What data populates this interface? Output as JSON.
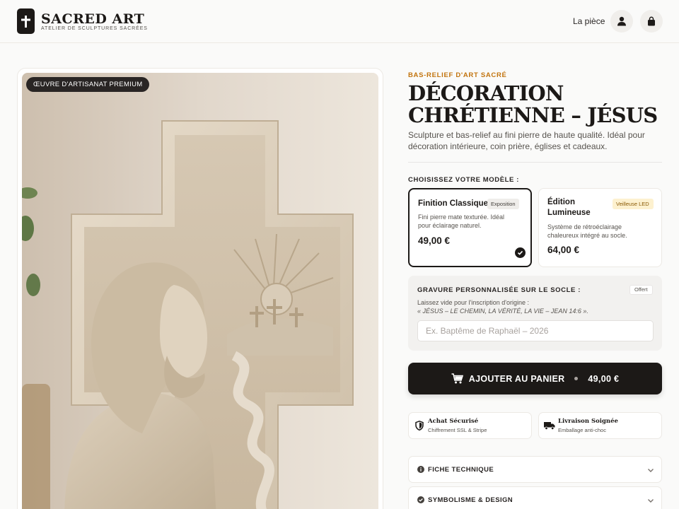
{
  "header": {
    "brand_name": "SACRED ART",
    "brand_tagline": "ATELIER DE SCULPTURES SACRÉES",
    "nav_link": "La pièce",
    "icons": [
      "cross-icon",
      "user-icon",
      "bag-icon"
    ]
  },
  "gallery": {
    "badge": "ŒUVRE D'ARTISANAT PREMIUM"
  },
  "product": {
    "eyebrow": "BAS-RELIEF D'ART SACRÉ",
    "title": "DÉCORATION CHRÉTIENNE – JÉSUS",
    "description": "Sculpture et bas-relief au fini pierre de haute qualité. Idéal pour décoration intérieure, coin prière, églises et cadeaux."
  },
  "model_select": {
    "label": "CHOISISSEZ VOTRE MODÈLE :",
    "options": [
      {
        "name": "Finition Classique",
        "tag": "Exposition",
        "text": "Fini pierre mate texturée. Idéal pour éclairage naturel.",
        "price": "49,00 €",
        "selected": true
      },
      {
        "name": "Édition Lumineuse",
        "tag": "Veilleuse LED",
        "text": "Système de rétroéclairage chaleureux intégré au socle.",
        "price": "64,00 €",
        "selected": false
      }
    ]
  },
  "engraving": {
    "title": "GRAVURE PERSONNALISÉE SUR LE SOCLE :",
    "badge": "Offert",
    "hint_line1": "Laissez vide pour l'inscription d'origine :",
    "hint_quote": "« JÉSUS – LE CHEMIN, LA VÉRITÉ, LA VIE – JEAN 14:6 ».",
    "input_value": "",
    "input_placeholder": "Ex. Baptême de Raphaël – 2026"
  },
  "cart": {
    "label": "AJOUTER AU PANIER",
    "price": "49,00 €"
  },
  "trust": [
    {
      "title": "Achat Sécurisé",
      "subtitle": "Chiffrement SSL & Stripe",
      "icon": "shield-icon"
    },
    {
      "title": "Livraison Soignée",
      "subtitle": "Emballage anti-choc",
      "icon": "truck-icon"
    }
  ],
  "accordion": [
    {
      "label": "FICHE TECHNIQUE",
      "icon": "info-icon",
      "expanded": false
    },
    {
      "label": "SYMBOLISME & DESIGN",
      "icon": "check-circle-icon",
      "expanded": false
    }
  ],
  "colors": {
    "accent": "#c2740f",
    "dark": "#1c1917",
    "background": "#fafaf9",
    "led_tag_bg": "#fdf1cf"
  }
}
